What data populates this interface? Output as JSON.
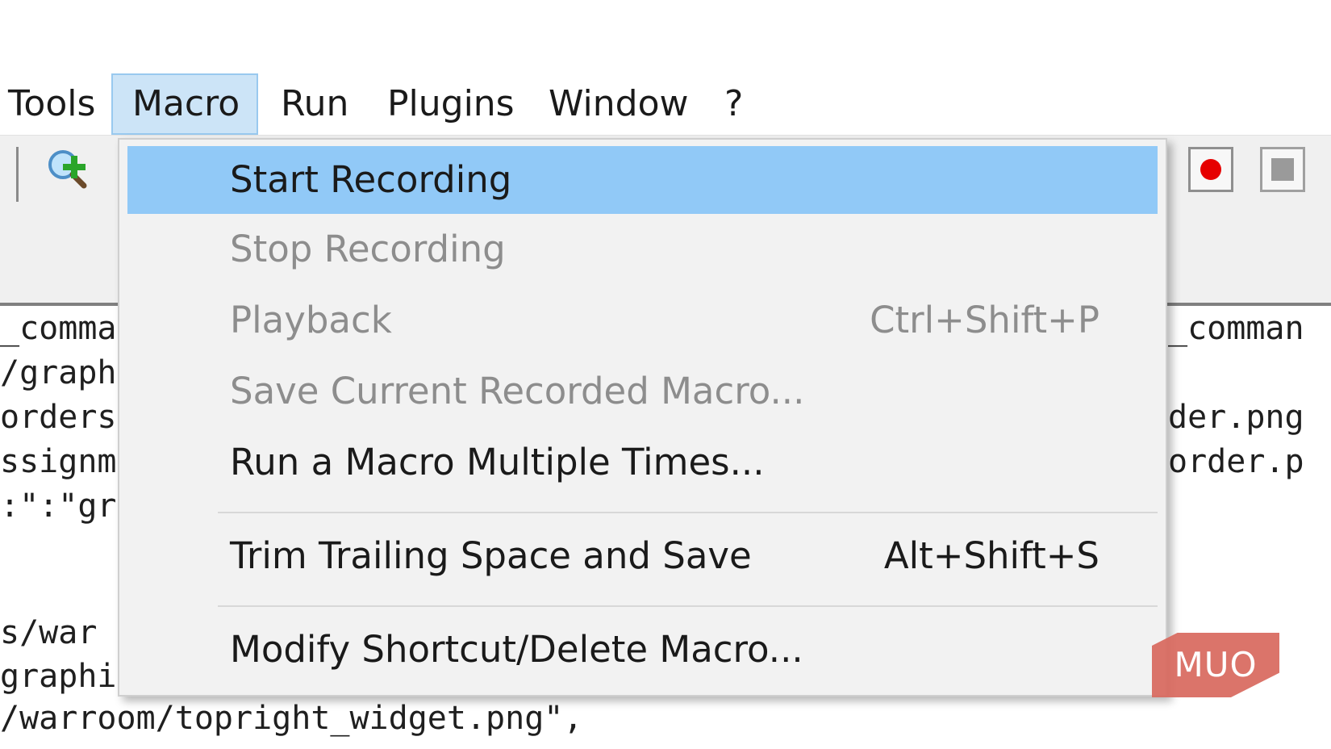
{
  "menubar": {
    "items": [
      {
        "label": "Tools"
      },
      {
        "label": "Macro",
        "active": true
      },
      {
        "label": "Run"
      },
      {
        "label": "Plugins"
      },
      {
        "label": "Window"
      },
      {
        "label": "?"
      }
    ]
  },
  "toolbar": {
    "buttons": [
      {
        "icon": "zoom-in-icon"
      },
      {
        "icon": "record-macro-icon"
      },
      {
        "icon": "stop-macro-icon"
      }
    ]
  },
  "editor": {
    "left_lines": [
      "_comma",
      "/graph",
      "orders",
      "ssignm",
      ":\":\"gr",
      "",
      "s/war",
      "graphi"
    ],
    "right_lines": [
      "_comman",
      "der.png",
      "order.p"
    ],
    "bottom_line": "/warroom/topright_widget.png\","
  },
  "macro_menu": {
    "items": [
      {
        "label": "Start Recording",
        "shortcut": "",
        "enabled": true,
        "highlighted": true
      },
      {
        "label": "Stop Recording",
        "shortcut": "",
        "enabled": false
      },
      {
        "label": "Playback",
        "shortcut": "Ctrl+Shift+P",
        "enabled": false
      },
      {
        "label": "Save Current Recorded Macro...",
        "shortcut": "",
        "enabled": false
      },
      {
        "label": "Run a Macro Multiple Times...",
        "shortcut": "",
        "enabled": true
      },
      {
        "label": "Trim Trailing Space and Save",
        "shortcut": "Alt+Shift+S",
        "enabled": true
      },
      {
        "label": "Modify Shortcut/Delete Macro...",
        "shortcut": "",
        "enabled": true
      }
    ]
  },
  "watermark": {
    "text": "MUO"
  },
  "colors": {
    "highlight": "#91c9f7",
    "menu_active_bg": "#cce4f7",
    "disabled_text": "#8d8d8d",
    "record_red": "#e60000",
    "watermark": "#d96a5f"
  }
}
